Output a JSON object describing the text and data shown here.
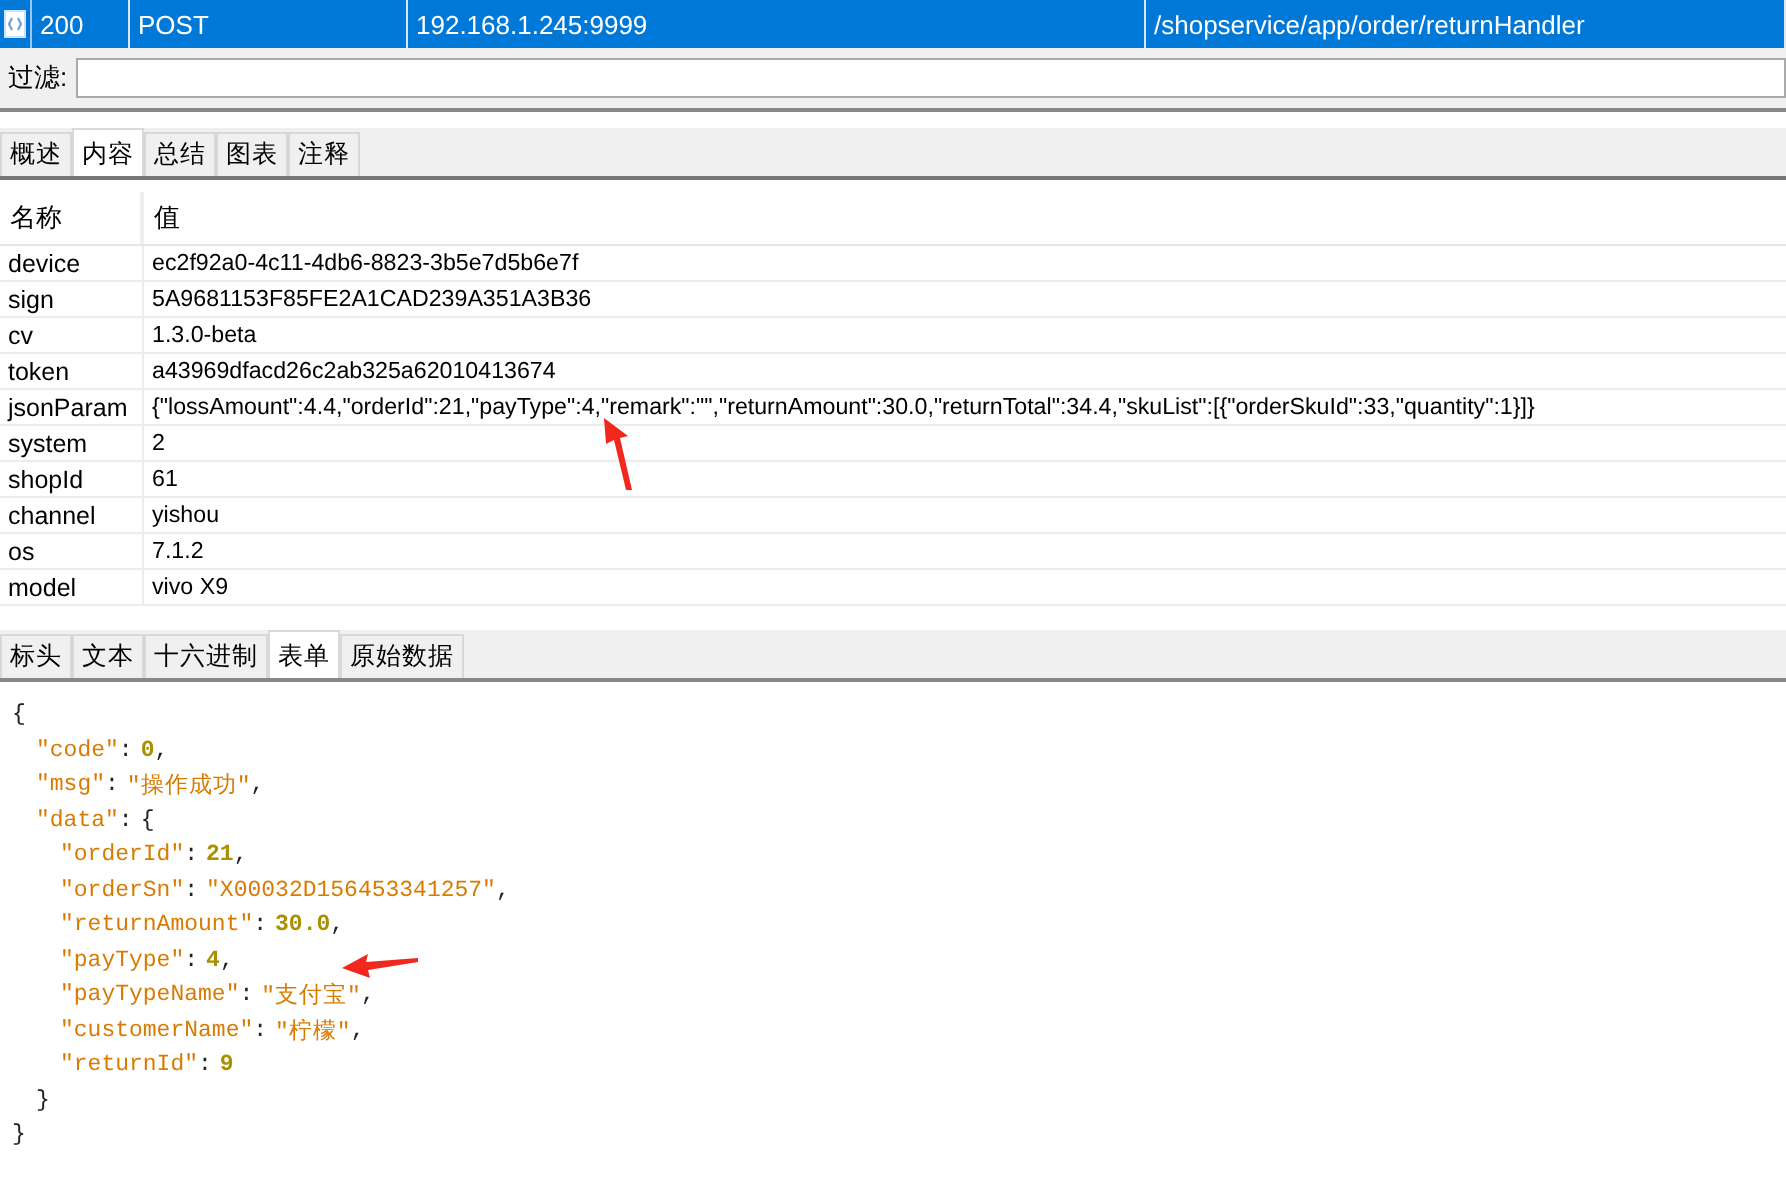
{
  "session_row": {
    "selected": true,
    "cells": [
      "200",
      "POST",
      "192.168.1.245:9999",
      "/shopservice/app/order/returnHandler"
    ]
  },
  "filter": {
    "label": "过滤:"
  },
  "request_tabs": [
    {
      "label": "概述",
      "selected": false
    },
    {
      "label": "内容",
      "selected": true
    },
    {
      "label": "总结",
      "selected": false
    },
    {
      "label": "图表",
      "selected": false
    },
    {
      "label": "注释",
      "selected": false
    }
  ],
  "params_table": {
    "columns": [
      "名称",
      "值"
    ],
    "rows": [
      {
        "name": "device",
        "value": "ec2f92a0-4c11-4db6-8823-3b5e7d5b6e7f"
      },
      {
        "name": "sign",
        "value": "5A9681153F85FE2A1CAD239A351A3B36"
      },
      {
        "name": "cv",
        "value": "1.3.0-beta"
      },
      {
        "name": "token",
        "value": "a43969dfacd26c2ab325a62010413674"
      },
      {
        "name": "jsonParam",
        "value": "{\"lossAmount\":4.4,\"orderId\":21,\"payType\":4,\"remark\":\"\",\"returnAmount\":30.0,\"returnTotal\":34.4,\"skuList\":[{\"orderSkuId\":33,\"quantity\":1}]}"
      },
      {
        "name": "system",
        "value": "2"
      },
      {
        "name": "shopId",
        "value": "61"
      },
      {
        "name": "channel",
        "value": "yishou"
      },
      {
        "name": "os",
        "value": "7.1.2"
      },
      {
        "name": "model",
        "value": "vivo X9"
      }
    ]
  },
  "response_tabs": [
    {
      "label": "标头",
      "selected": false
    },
    {
      "label": "文本",
      "selected": false
    },
    {
      "label": "十六进制",
      "selected": false
    },
    {
      "label": "表单",
      "selected": true
    },
    {
      "label": "原始数据",
      "selected": false
    }
  ],
  "response_json": [
    {
      "tokens": [
        {
          "kind": "punct",
          "text": "{"
        }
      ],
      "children": [
        {
          "tokens": [
            {
              "kind": "key",
              "text": "\"code\""
            },
            {
              "kind": "punct",
              "text": ":"
            },
            {
              "kind": "number",
              "text": "0"
            },
            {
              "kind": "punct",
              "text": ","
            }
          ]
        },
        {
          "tokens": [
            {
              "kind": "key",
              "text": "\"msg\""
            },
            {
              "kind": "punct",
              "text": ":"
            },
            {
              "kind": "string",
              "text": "\"操作成功\""
            },
            {
              "kind": "punct",
              "text": ","
            }
          ]
        },
        {
          "tokens": [
            {
              "kind": "key",
              "text": "\"data\""
            },
            {
              "kind": "punct",
              "text": ":"
            },
            {
              "kind": "punct",
              "text": "{"
            }
          ],
          "children": [
            {
              "tokens": [
                {
                  "kind": "key",
                  "text": "\"orderId\""
                },
                {
                  "kind": "punct",
                  "text": ":"
                },
                {
                  "kind": "number",
                  "text": "21"
                },
                {
                  "kind": "punct",
                  "text": ","
                }
              ]
            },
            {
              "tokens": [
                {
                  "kind": "key",
                  "text": "\"orderSn\""
                },
                {
                  "kind": "punct",
                  "text": ":"
                },
                {
                  "kind": "string",
                  "text": "\"X00032D156453341257\""
                },
                {
                  "kind": "punct",
                  "text": ","
                }
              ]
            },
            {
              "tokens": [
                {
                  "kind": "key",
                  "text": "\"returnAmount\""
                },
                {
                  "kind": "punct",
                  "text": ":"
                },
                {
                  "kind": "number",
                  "text": "30.0"
                },
                {
                  "kind": "punct",
                  "text": ","
                }
              ]
            },
            {
              "tokens": [
                {
                  "kind": "key",
                  "text": "\"payType\""
                },
                {
                  "kind": "punct",
                  "text": ":"
                },
                {
                  "kind": "number",
                  "text": "4"
                },
                {
                  "kind": "punct",
                  "text": ","
                }
              ]
            },
            {
              "tokens": [
                {
                  "kind": "key",
                  "text": "\"payTypeName\""
                },
                {
                  "kind": "punct",
                  "text": ":"
                },
                {
                  "kind": "string",
                  "text": "\"支付宝\""
                },
                {
                  "kind": "punct",
                  "text": ","
                }
              ]
            },
            {
              "tokens": [
                {
                  "kind": "key",
                  "text": "\"customerName\""
                },
                {
                  "kind": "punct",
                  "text": ":"
                },
                {
                  "kind": "string",
                  "text": "\"柠檬\""
                },
                {
                  "kind": "punct",
                  "text": ","
                }
              ]
            },
            {
              "tokens": [
                {
                  "kind": "key",
                  "text": "\"returnId\""
                },
                {
                  "kind": "punct",
                  "text": ":"
                },
                {
                  "kind": "number",
                  "text": "9"
                }
              ]
            }
          ]
        },
        {
          "tokens": [
            {
              "kind": "punct",
              "text": "}"
            }
          ]
        }
      ]
    },
    {
      "tokens": [
        {
          "kind": "punct",
          "text": "}"
        }
      ]
    }
  ]
}
